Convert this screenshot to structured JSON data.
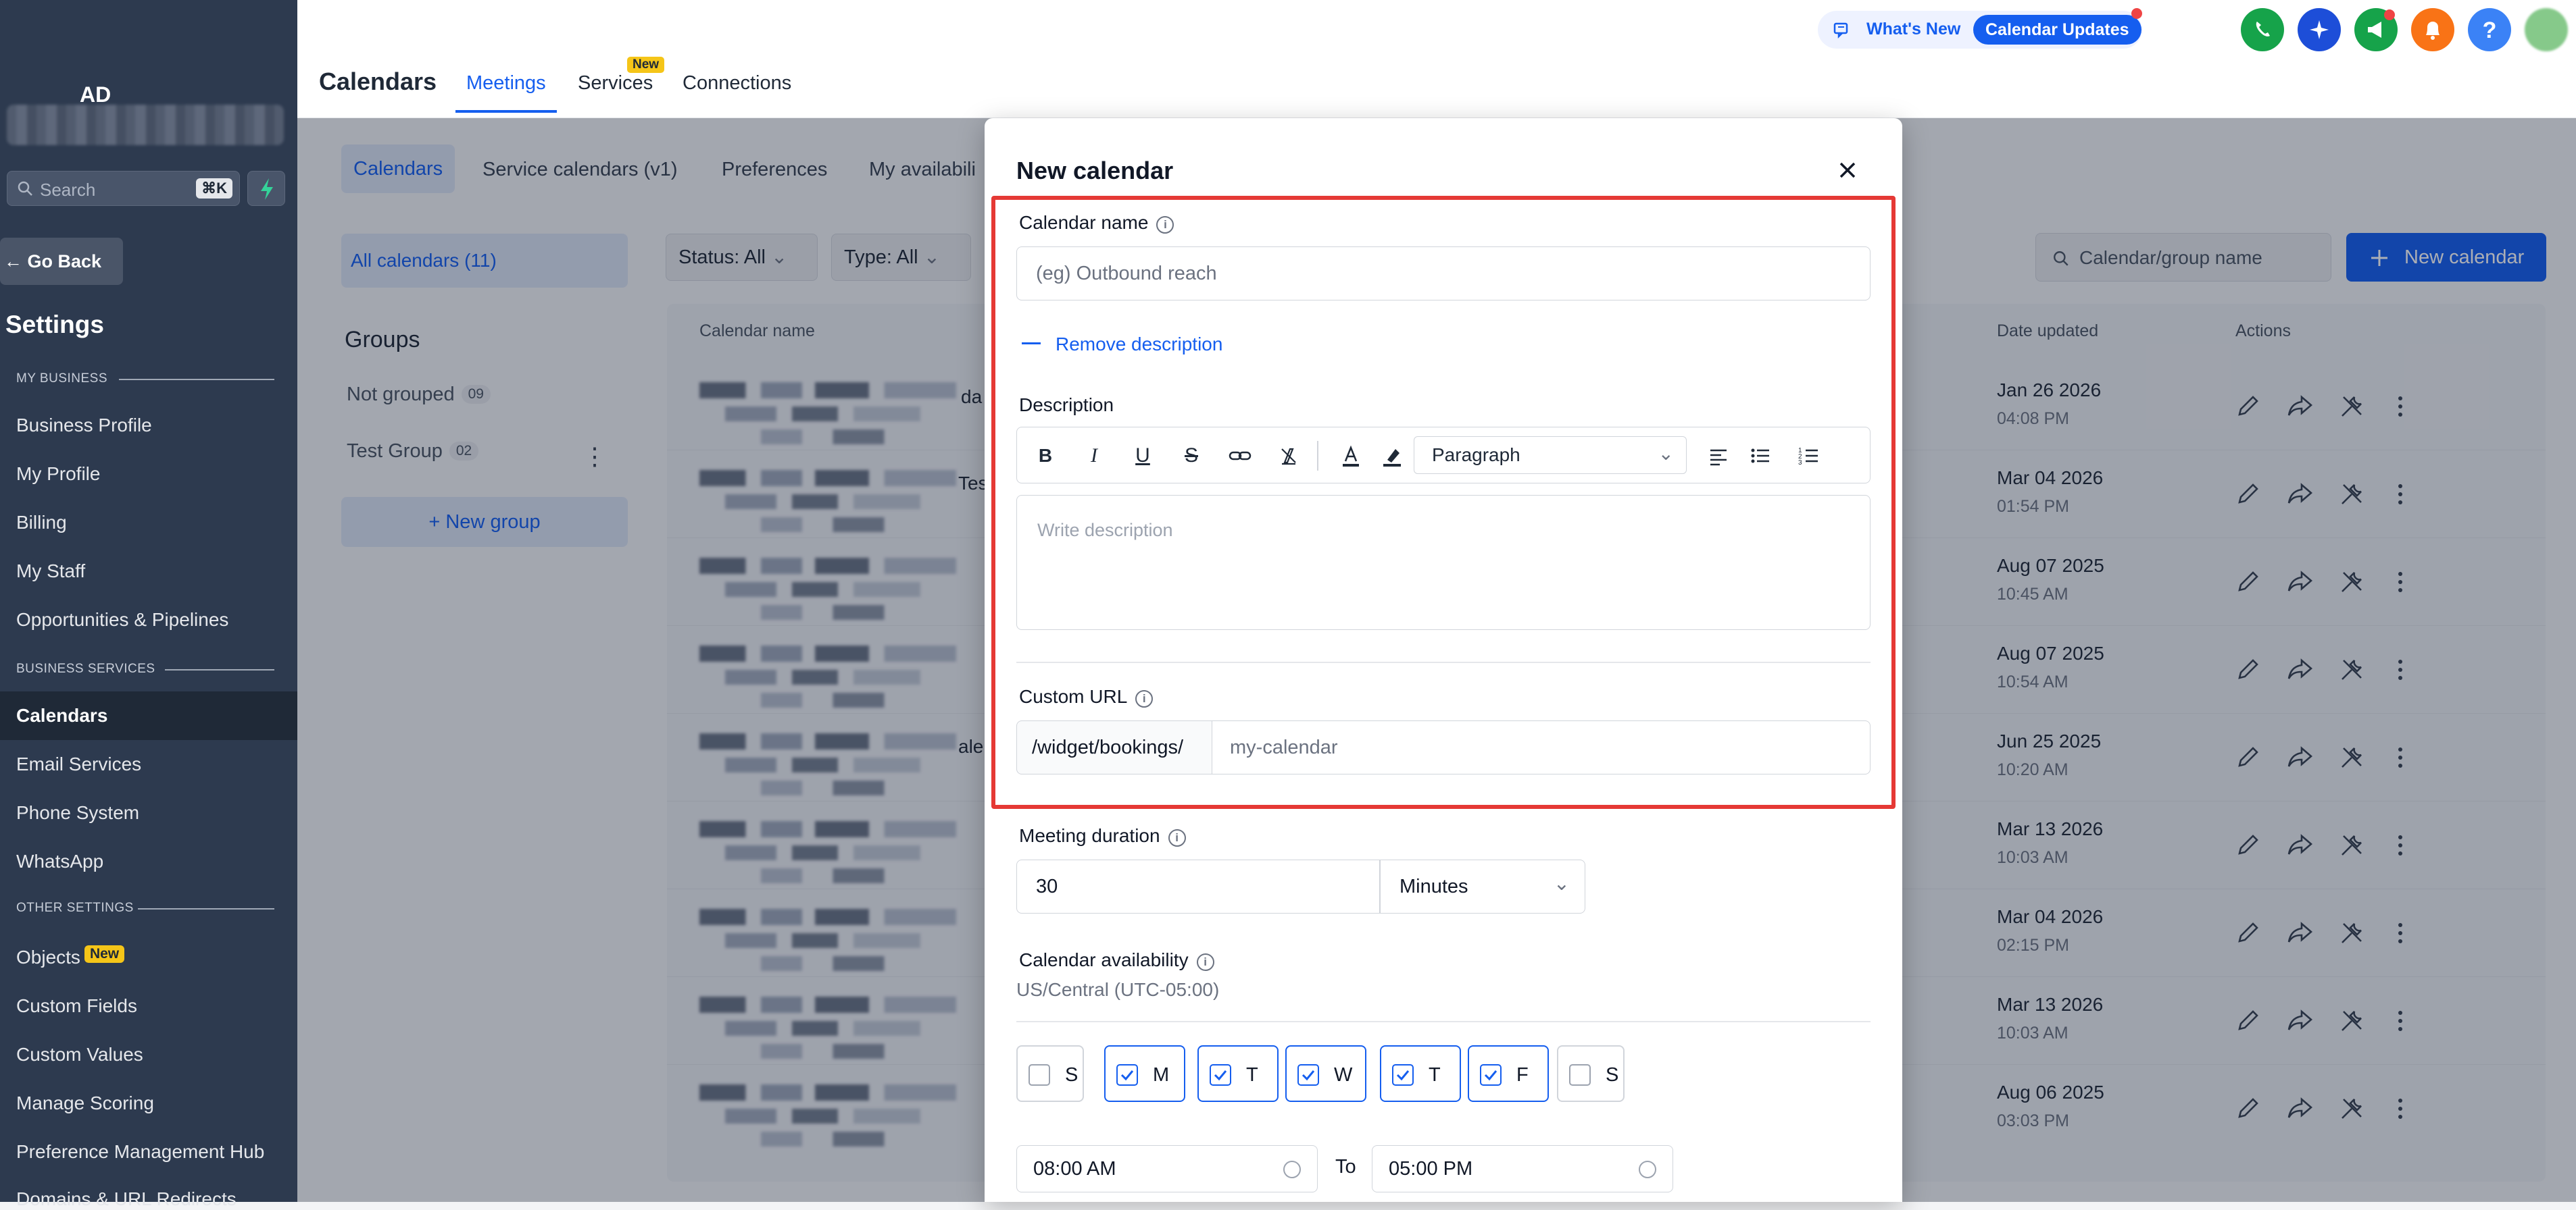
{
  "sidebar": {
    "brand": "AD",
    "search_placeholder": "Search",
    "search_shortcut": "⌘K",
    "go_back": "Go Back",
    "settings_title": "Settings",
    "sections": {
      "my_business": "MY BUSINESS",
      "business_services": "BUSINESS SERVICES",
      "other_settings": "OTHER SETTINGS"
    },
    "items": {
      "business_profile": "Business Profile",
      "my_profile": "My Profile",
      "billing": "Billing",
      "my_staff": "My Staff",
      "opportunities": "Opportunities & Pipelines",
      "calendars": "Calendars",
      "email_services": "Email Services",
      "phone_system": "Phone System",
      "whatsapp": "WhatsApp",
      "objects": "Objects",
      "objects_badge": "New",
      "custom_fields": "Custom Fields",
      "custom_values": "Custom Values",
      "manage_scoring": "Manage Scoring",
      "preference_hub": "Preference Management Hub",
      "domains": "Domains & URL Redirects"
    }
  },
  "header": {
    "title": "Calendars",
    "tabs": {
      "meetings": "Meetings",
      "services": "Services",
      "services_badge": "New",
      "connections": "Connections"
    },
    "whats_new": "What's New",
    "calendar_updates": "Calendar Updates"
  },
  "content": {
    "subtabs": {
      "calendars": "Calendars",
      "service_calendars": "Service calendars (v1)",
      "preferences": "Preferences",
      "my_availability": "My availabili"
    },
    "all_calendars": "All calendars (11)",
    "groups_title": "Groups",
    "groups": [
      {
        "name": "Not grouped",
        "count": "09"
      },
      {
        "name": "Test Group",
        "count": "02"
      }
    ],
    "new_group": "+ New group",
    "filters": {
      "status": "Status: All",
      "type": "Type: All"
    },
    "search_placeholder": "Calendar/group name",
    "new_calendar_button": "New calendar",
    "columns": {
      "name": "Calendar name",
      "date_updated": "Date updated",
      "actions": "Actions"
    },
    "row_fragments": [
      "da",
      "Tes",
      "ale"
    ],
    "rows": [
      {
        "date": "Jan 26 2026",
        "time": "04:08 PM"
      },
      {
        "date": "Mar 04 2026",
        "time": "01:54 PM"
      },
      {
        "date": "Aug 07 2025",
        "time": "10:45 AM"
      },
      {
        "date": "Aug 07 2025",
        "time": "10:54 AM"
      },
      {
        "date": "Jun 25 2025",
        "time": "10:20 AM"
      },
      {
        "date": "Mar 13 2026",
        "time": "10:03 AM"
      },
      {
        "date": "Mar 04 2026",
        "time": "02:15 PM"
      },
      {
        "date": "Mar 13 2026",
        "time": "10:03 AM"
      },
      {
        "date": "Aug 06 2025",
        "time": "03:03 PM"
      }
    ]
  },
  "modal": {
    "title": "New calendar",
    "calendar_name_label": "Calendar name",
    "calendar_name_placeholder": "(eg) Outbound reach",
    "remove_description": "Remove description",
    "description_label": "Description",
    "paragraph_option": "Paragraph",
    "description_placeholder": "Write description",
    "custom_url_label": "Custom URL",
    "url_prefix": "/widget/bookings/",
    "url_placeholder": "my-calendar",
    "meeting_duration_label": "Meeting duration",
    "duration_value": "30",
    "duration_unit": "Minutes",
    "availability_label": "Calendar availability",
    "timezone": "US/Central (UTC-05:00)",
    "days": [
      {
        "label": "S",
        "checked": false
      },
      {
        "label": "M",
        "checked": true
      },
      {
        "label": "T",
        "checked": true
      },
      {
        "label": "W",
        "checked": true
      },
      {
        "label": "T",
        "checked": true
      },
      {
        "label": "F",
        "checked": true
      },
      {
        "label": "S",
        "checked": false
      }
    ],
    "start_time": "08:00 AM",
    "to_label": "To",
    "end_time": "05:00 PM"
  },
  "colors": {
    "accent": "#155eef",
    "highlight": "#e53935",
    "sidebar": "#2d3a4f"
  }
}
